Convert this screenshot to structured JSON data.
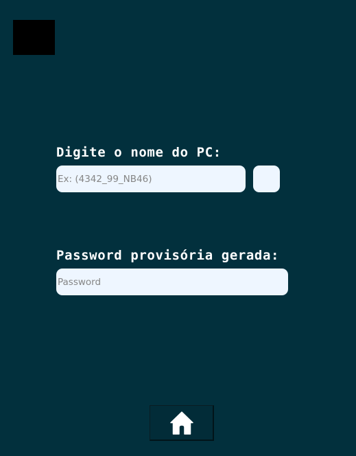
{
  "window": {
    "background_color": "#02303d"
  },
  "form": {
    "pc_name_label": "Digite o nome do PC:",
    "pc_name_placeholder": "Ex: (4342_99_NB46)",
    "pc_name_value": "",
    "password_label": "Password provisória gerada:",
    "password_placeholder": "Password",
    "password_value": ""
  },
  "colors": {
    "field_background": "#eef6ff",
    "label_text": "#ffffff",
    "logo_placeholder": "#000000"
  },
  "icons": {
    "home_button_icon": "home-icon"
  }
}
